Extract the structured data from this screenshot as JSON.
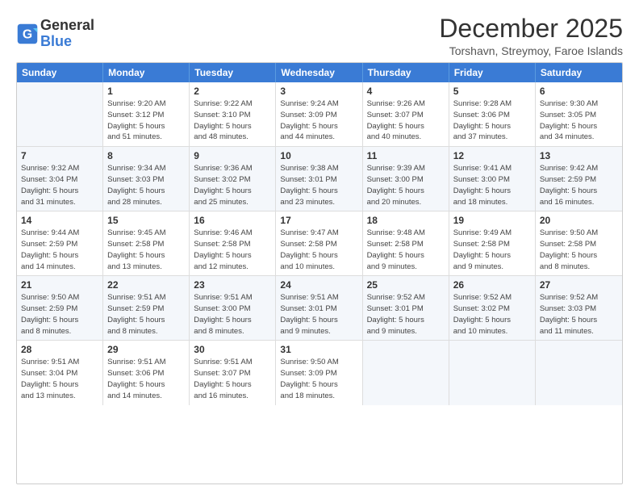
{
  "header": {
    "logo_line1": "General",
    "logo_line2": "Blue",
    "month_title": "December 2025",
    "location": "Torshavn, Streymoy, Faroe Islands"
  },
  "weekdays": [
    "Sunday",
    "Monday",
    "Tuesday",
    "Wednesday",
    "Thursday",
    "Friday",
    "Saturday"
  ],
  "rows": [
    [
      {
        "day": "",
        "info": ""
      },
      {
        "day": "1",
        "info": "Sunrise: 9:20 AM\nSunset: 3:12 PM\nDaylight: 5 hours\nand 51 minutes."
      },
      {
        "day": "2",
        "info": "Sunrise: 9:22 AM\nSunset: 3:10 PM\nDaylight: 5 hours\nand 48 minutes."
      },
      {
        "day": "3",
        "info": "Sunrise: 9:24 AM\nSunset: 3:09 PM\nDaylight: 5 hours\nand 44 minutes."
      },
      {
        "day": "4",
        "info": "Sunrise: 9:26 AM\nSunset: 3:07 PM\nDaylight: 5 hours\nand 40 minutes."
      },
      {
        "day": "5",
        "info": "Sunrise: 9:28 AM\nSunset: 3:06 PM\nDaylight: 5 hours\nand 37 minutes."
      },
      {
        "day": "6",
        "info": "Sunrise: 9:30 AM\nSunset: 3:05 PM\nDaylight: 5 hours\nand 34 minutes."
      }
    ],
    [
      {
        "day": "7",
        "info": "Sunrise: 9:32 AM\nSunset: 3:04 PM\nDaylight: 5 hours\nand 31 minutes."
      },
      {
        "day": "8",
        "info": "Sunrise: 9:34 AM\nSunset: 3:03 PM\nDaylight: 5 hours\nand 28 minutes."
      },
      {
        "day": "9",
        "info": "Sunrise: 9:36 AM\nSunset: 3:02 PM\nDaylight: 5 hours\nand 25 minutes."
      },
      {
        "day": "10",
        "info": "Sunrise: 9:38 AM\nSunset: 3:01 PM\nDaylight: 5 hours\nand 23 minutes."
      },
      {
        "day": "11",
        "info": "Sunrise: 9:39 AM\nSunset: 3:00 PM\nDaylight: 5 hours\nand 20 minutes."
      },
      {
        "day": "12",
        "info": "Sunrise: 9:41 AM\nSunset: 3:00 PM\nDaylight: 5 hours\nand 18 minutes."
      },
      {
        "day": "13",
        "info": "Sunrise: 9:42 AM\nSunset: 2:59 PM\nDaylight: 5 hours\nand 16 minutes."
      }
    ],
    [
      {
        "day": "14",
        "info": "Sunrise: 9:44 AM\nSunset: 2:59 PM\nDaylight: 5 hours\nand 14 minutes."
      },
      {
        "day": "15",
        "info": "Sunrise: 9:45 AM\nSunset: 2:58 PM\nDaylight: 5 hours\nand 13 minutes."
      },
      {
        "day": "16",
        "info": "Sunrise: 9:46 AM\nSunset: 2:58 PM\nDaylight: 5 hours\nand 12 minutes."
      },
      {
        "day": "17",
        "info": "Sunrise: 9:47 AM\nSunset: 2:58 PM\nDaylight: 5 hours\nand 10 minutes."
      },
      {
        "day": "18",
        "info": "Sunrise: 9:48 AM\nSunset: 2:58 PM\nDaylight: 5 hours\nand 9 minutes."
      },
      {
        "day": "19",
        "info": "Sunrise: 9:49 AM\nSunset: 2:58 PM\nDaylight: 5 hours\nand 9 minutes."
      },
      {
        "day": "20",
        "info": "Sunrise: 9:50 AM\nSunset: 2:58 PM\nDaylight: 5 hours\nand 8 minutes."
      }
    ],
    [
      {
        "day": "21",
        "info": "Sunrise: 9:50 AM\nSunset: 2:59 PM\nDaylight: 5 hours\nand 8 minutes."
      },
      {
        "day": "22",
        "info": "Sunrise: 9:51 AM\nSunset: 2:59 PM\nDaylight: 5 hours\nand 8 minutes."
      },
      {
        "day": "23",
        "info": "Sunrise: 9:51 AM\nSunset: 3:00 PM\nDaylight: 5 hours\nand 8 minutes."
      },
      {
        "day": "24",
        "info": "Sunrise: 9:51 AM\nSunset: 3:01 PM\nDaylight: 5 hours\nand 9 minutes."
      },
      {
        "day": "25",
        "info": "Sunrise: 9:52 AM\nSunset: 3:01 PM\nDaylight: 5 hours\nand 9 minutes."
      },
      {
        "day": "26",
        "info": "Sunrise: 9:52 AM\nSunset: 3:02 PM\nDaylight: 5 hours\nand 10 minutes."
      },
      {
        "day": "27",
        "info": "Sunrise: 9:52 AM\nSunset: 3:03 PM\nDaylight: 5 hours\nand 11 minutes."
      }
    ],
    [
      {
        "day": "28",
        "info": "Sunrise: 9:51 AM\nSunset: 3:04 PM\nDaylight: 5 hours\nand 13 minutes."
      },
      {
        "day": "29",
        "info": "Sunrise: 9:51 AM\nSunset: 3:06 PM\nDaylight: 5 hours\nand 14 minutes."
      },
      {
        "day": "30",
        "info": "Sunrise: 9:51 AM\nSunset: 3:07 PM\nDaylight: 5 hours\nand 16 minutes."
      },
      {
        "day": "31",
        "info": "Sunrise: 9:50 AM\nSunset: 3:09 PM\nDaylight: 5 hours\nand 18 minutes."
      },
      {
        "day": "",
        "info": ""
      },
      {
        "day": "",
        "info": ""
      },
      {
        "day": "",
        "info": ""
      }
    ]
  ]
}
